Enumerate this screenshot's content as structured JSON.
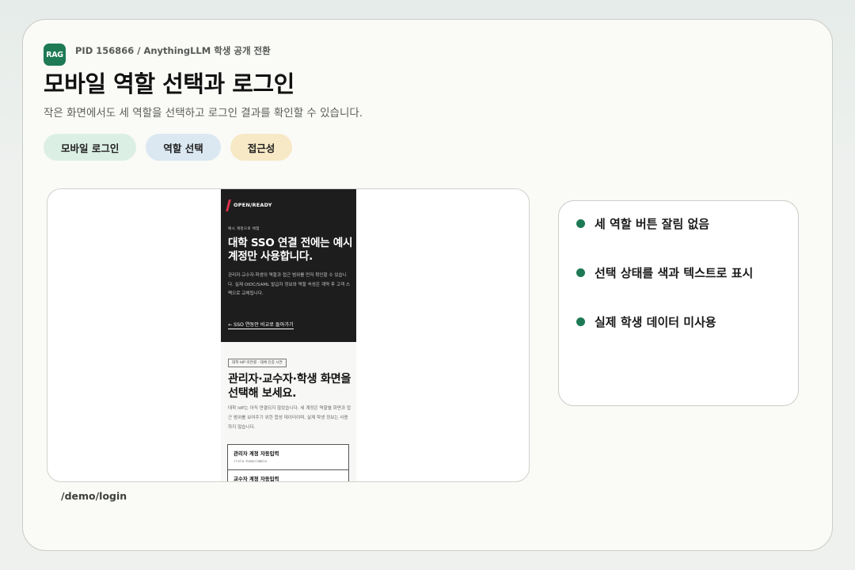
{
  "header": {
    "badge": "RAG",
    "eyebrow": "PID 156866 / AnythingLLM 학생 공개 전환",
    "title": "모바일 역할 선택과 로그인",
    "subtitle": "작은 화면에서도 세 역할을 선택하고 로그인 결과를 확인할 수 있습니다."
  },
  "chips": [
    {
      "label": "모바일 로그인",
      "color": "#dcefe5"
    },
    {
      "label": "역할 선택",
      "color": "#dbe8f2"
    },
    {
      "label": "접근성",
      "color": "#f7e9c6"
    }
  ],
  "phone": {
    "brand": "OPEN/READY",
    "demo_label": "예시 계정으로 체험",
    "dark_heading": "대학 SSO 연결 전에는 예시 계정만 사용합니다.",
    "dark_desc": "관리자·교수자·학생의 역할과 접근 범위를 먼저 확인할 수 있습니다. 실제 OIDC/SAML 발급자 정보와 역할 속성은 계약 후 고객 스펙으로 교체됩니다.",
    "back_link": "← SSO 연동안 비교로 돌아가기",
    "tag": "대학 IdP 미연결 · 대체 인증 시연",
    "light_heading": "관리자·교수자·학생 화면을 선택해 보세요.",
    "light_desc": "대학 IdP는 아직 연결되지 않았습니다. 세 계정은 역할별 화면과 접근 범위를 보여주기 위한 합성 데이터이며, 실제 학생 정보는 사용하지 않습니다.",
    "roles": [
      {
        "title": "관리자 계정 자동입력",
        "path": "/role-home/admin"
      },
      {
        "title": "교수자 계정 자동입력",
        "path": ""
      }
    ]
  },
  "route": "/demo/login",
  "checklist": [
    "세 역할 버튼 잘림 없음",
    "선택 상태를 색과 텍스트로 표시",
    "실제 학생 데이터 미사용"
  ],
  "colors": {
    "accent": "#1d7a55",
    "slash": "#d9324a",
    "dark_panel": "#1d1d1d"
  }
}
